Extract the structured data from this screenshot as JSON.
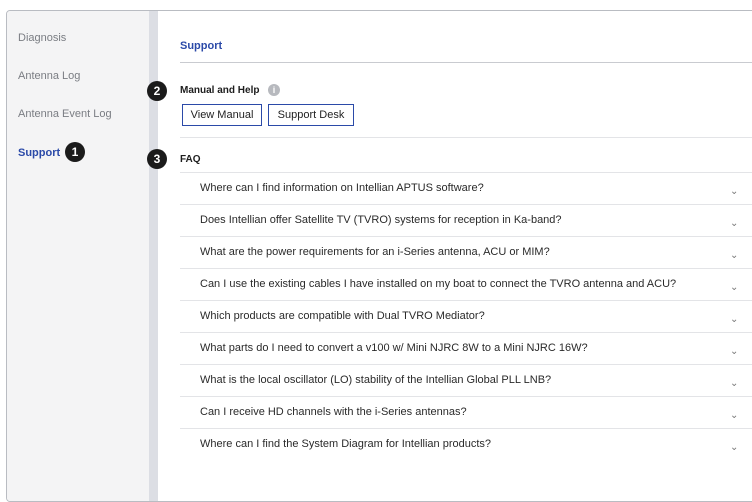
{
  "sidebar": {
    "items": [
      {
        "label": "Diagnosis"
      },
      {
        "label": "Antenna Log"
      },
      {
        "label": "Antenna Event Log"
      },
      {
        "label": "Support"
      }
    ]
  },
  "callouts": [
    "1",
    "2",
    "3"
  ],
  "support": {
    "title": "Support",
    "manual_heading": "Manual and Help",
    "info_icon": "i",
    "view_manual_label": "View Manual",
    "support_desk_label": "Support Desk",
    "faq_heading": "FAQ",
    "chevron": "⌄",
    "faq": [
      "Where can I find information on Intellian APTUS software?",
      "Does Intellian offer Satellite TV (TVRO) systems for reception in Ka-band?",
      "What are the power requirements for an i-Series antenna, ACU or MIM?",
      "Can I use the existing cables I have installed on my boat to connect the TVRO antenna and ACU?",
      "Which products are compatible with Dual TVRO Mediator?",
      "What parts do I need to convert a v100 w/ Mini NJRC 8W to a Mini NJRC 16W?",
      "What is the local oscillator (LO) stability of the Intellian Global PLL LNB?",
      "Can I receive HD channels with the i-Series antennas?",
      "Where can I find the System Diagram for Intellian products?"
    ]
  }
}
